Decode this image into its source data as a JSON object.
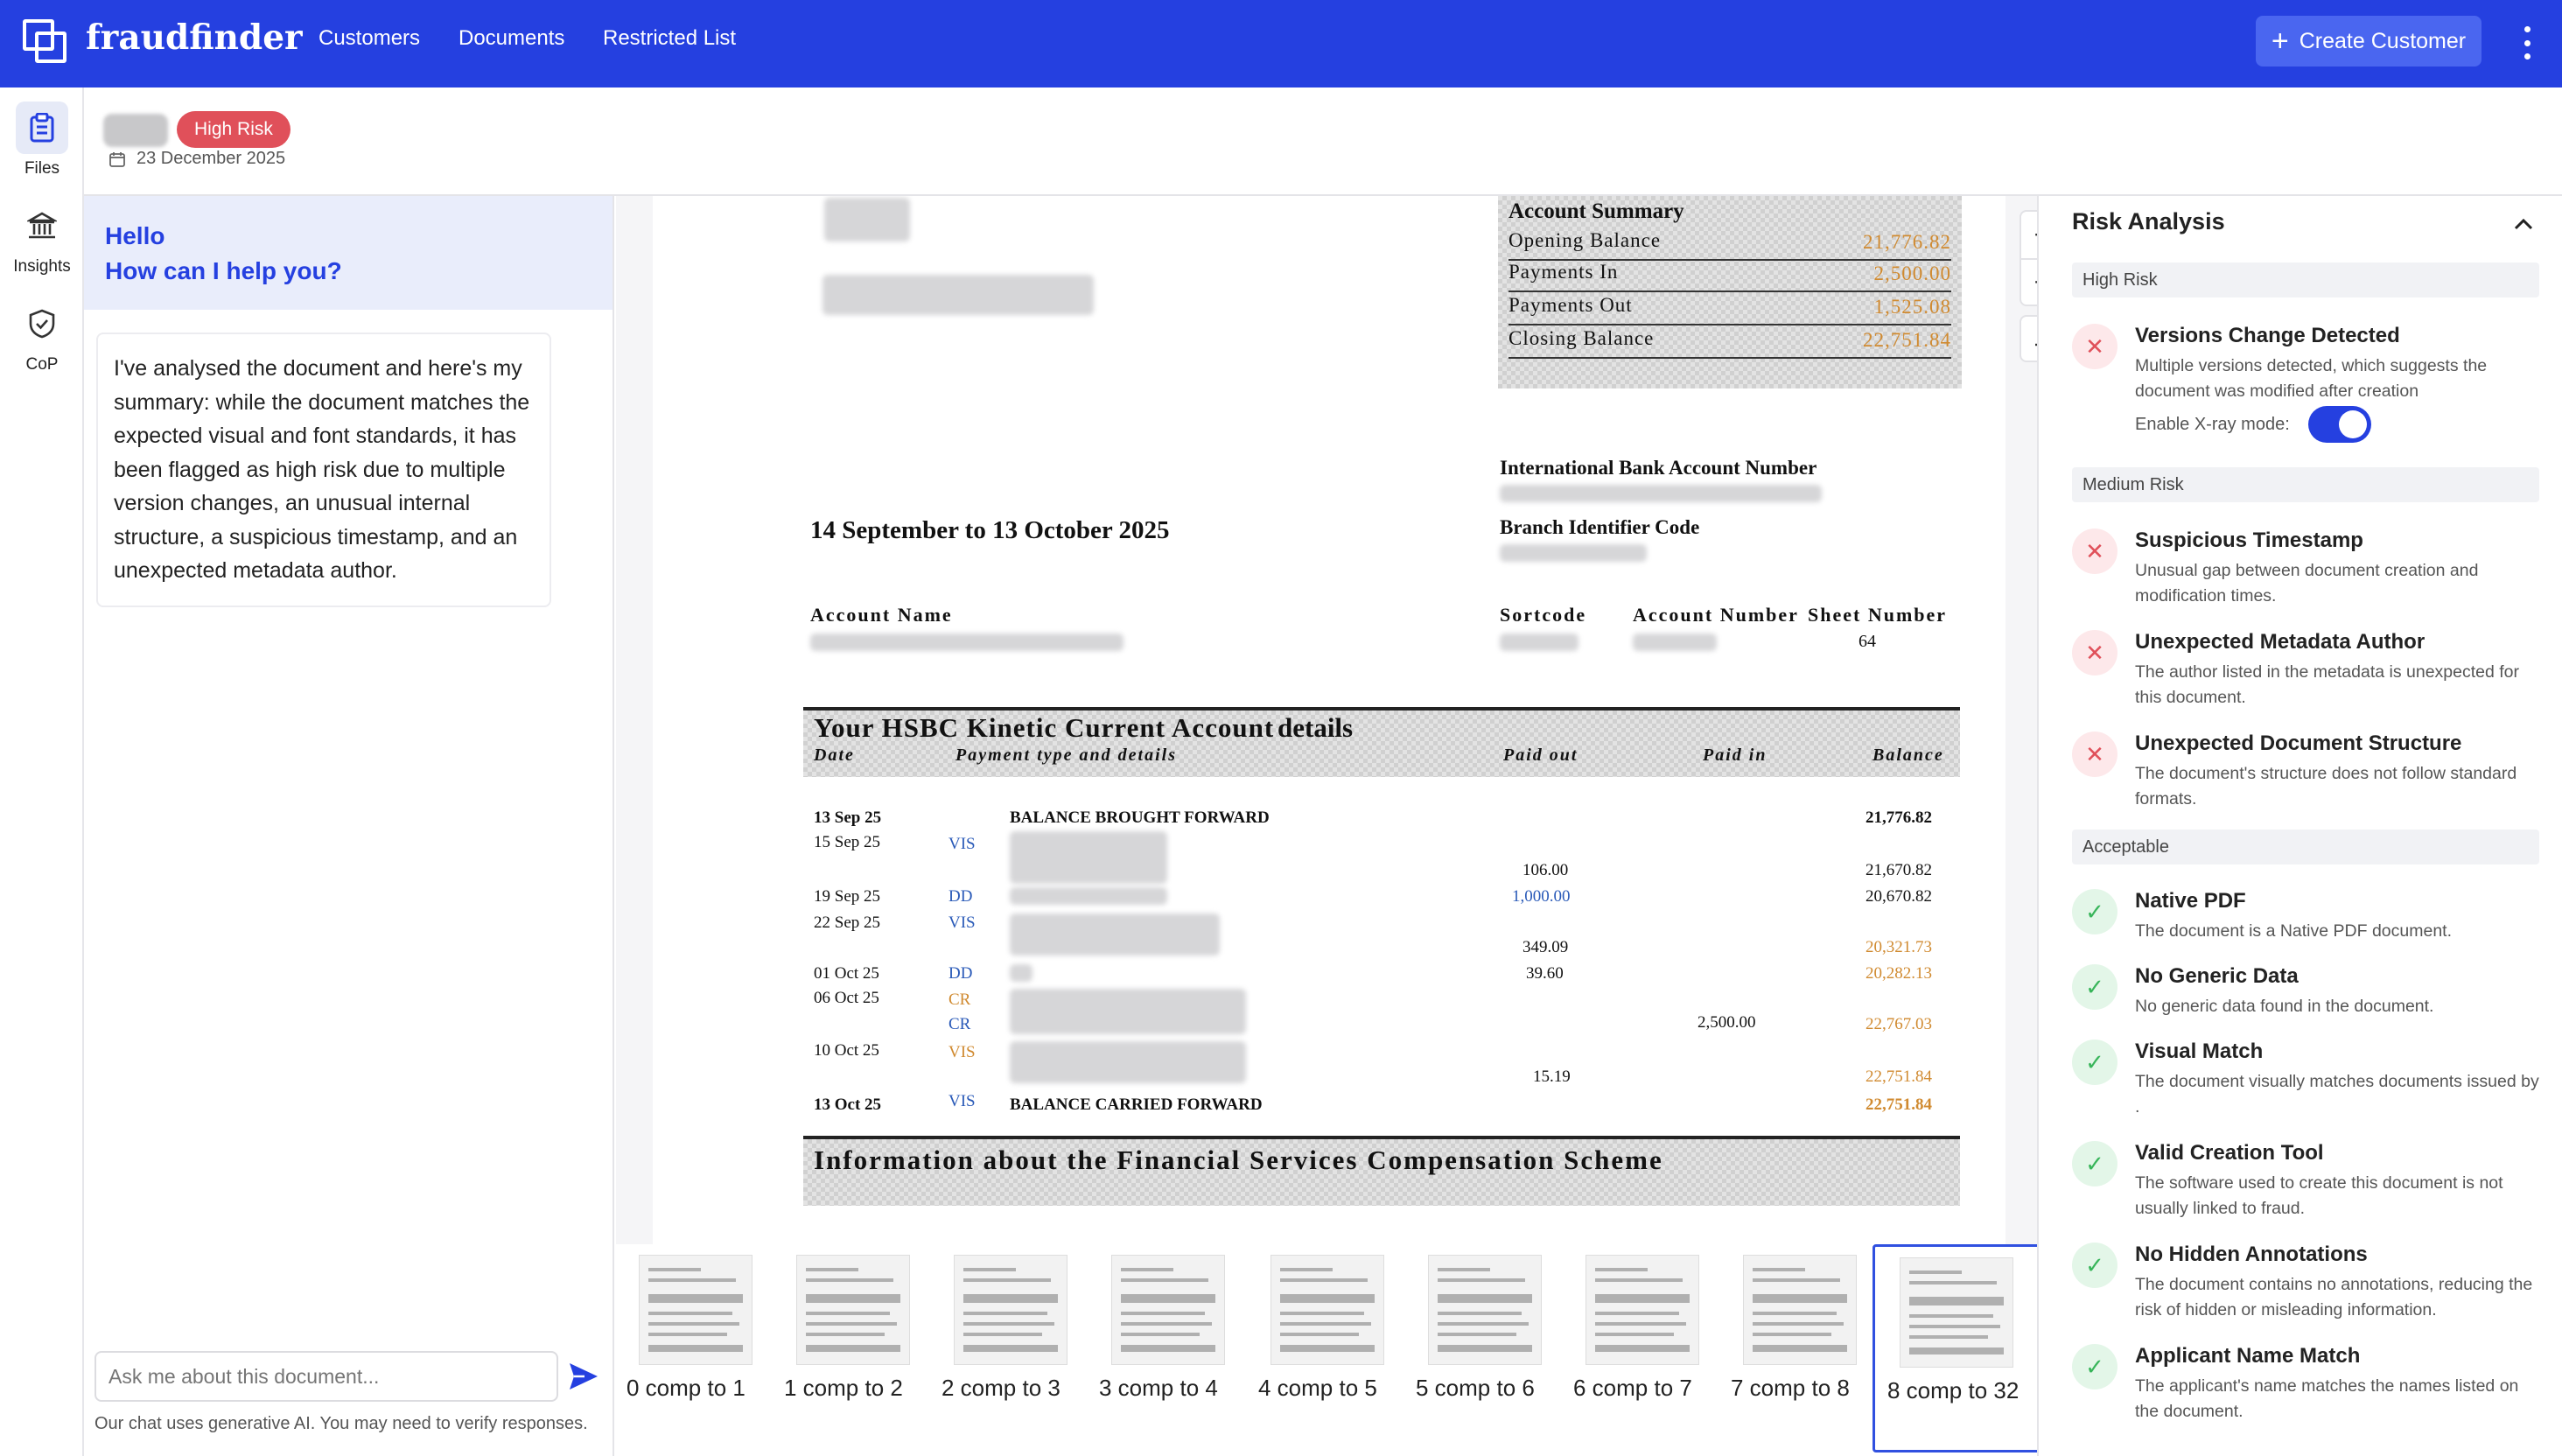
{
  "app": {
    "brand": "fraudfinder",
    "nav": [
      "Customers",
      "Documents",
      "Restricted List"
    ],
    "create_button": "Create Customer"
  },
  "rail": {
    "items": [
      {
        "label": "Files",
        "icon": "clipboard-icon"
      },
      {
        "label": "Insights",
        "icon": "bank-icon"
      },
      {
        "label": "CoP",
        "icon": "shield-check-icon"
      }
    ]
  },
  "header": {
    "risk_badge": "High Risk",
    "date": "23 December 2025"
  },
  "chat": {
    "greeting_1": "Hello",
    "greeting_2": "How can I help you?",
    "message": "I've analysed the document and here's my summary: while the document matches the expected visual and font standards, it has been flagged as high risk due to multiple version changes, an unusual internal structure, a suspicious timestamp, and an unexpected metadata author.",
    "input_placeholder": "Ask me about this document...",
    "disclaimer": "Our chat uses generative AI. You may need to verify responses."
  },
  "document": {
    "summary_title": "Account Summary",
    "summary_rows": [
      {
        "label": "Opening Balance",
        "value": "21,776.82"
      },
      {
        "label": "Payments In",
        "value": "2,500.00"
      },
      {
        "label": "Payments Out",
        "value": "1,525.08"
      },
      {
        "label": "Closing Balance",
        "value": "22,751.84"
      }
    ],
    "iban_label": "International Bank Account Number",
    "bic_label": "Branch Identifier Code",
    "period": "14 September to 13 October 2025",
    "account_name_label": "Account Name",
    "sortcode_label": "Sortcode",
    "account_number_label": "Account Number",
    "sheet_number_label": "Sheet Number",
    "sheet_number": "64",
    "account_title": "Your HSBC Kinetic Current Account",
    "details_word": "details",
    "col_date": "Date",
    "col_payment": "Payment type and details",
    "col_paid_out": "Paid out",
    "col_paid_in": "Paid in",
    "col_balance": "Balance",
    "transactions": [
      {
        "date": "13 Sep 25",
        "type": "",
        "details": "BALANCE BROUGHT FORWARD",
        "out": "",
        "in": "",
        "balance": "21,776.82"
      },
      {
        "date": "15 Sep 25",
        "type": "VIS",
        "details": "",
        "out": "106.00",
        "in": "",
        "balance": "21,670.82"
      },
      {
        "date": "19 Sep 25",
        "type": "DD",
        "details": "",
        "out": "1,000.00",
        "in": "",
        "balance": "20,670.82"
      },
      {
        "date": "22 Sep 25",
        "type": "VIS",
        "details": "",
        "out": "349.09",
        "in": "",
        "balance": "20,321.73"
      },
      {
        "date": "01 Oct 25",
        "type": "DD",
        "details": "",
        "out": "39.60",
        "in": "",
        "balance": "20,282.13"
      },
      {
        "date": "06 Oct 25",
        "type": "CR",
        "details": "",
        "out": "",
        "in": "",
        "balance": ""
      },
      {
        "date": "",
        "type": "CR",
        "details": "",
        "out": "",
        "in": "2,500.00",
        "balance": "22,767.03"
      },
      {
        "date": "10 Oct 25",
        "type": "VIS",
        "details": "",
        "out": "15.19",
        "in": "",
        "balance": "22,751.84"
      },
      {
        "date": "13 Oct 25",
        "type": "VIS",
        "details": "BALANCE CARRIED FORWARD",
        "out": "",
        "in": "",
        "balance": "22,751.84"
      }
    ],
    "fscs_title": "Information about the Financial Services Compensation Scheme"
  },
  "thumbnails": [
    "0 comp to 1",
    "1 comp to 2",
    "2 comp to 3",
    "3 comp to 4",
    "4 comp to 5",
    "5 comp to 6",
    "6 comp to 7",
    "7 comp to 8",
    "8 comp to 32"
  ],
  "risk": {
    "title": "Risk Analysis",
    "high_label": "High Risk",
    "versions": {
      "title": "Versions Change Detected",
      "desc": "Multiple versions detected, which suggests the document was modified after creation"
    },
    "xray_label": "Enable X-ray mode:",
    "xray_enabled": true,
    "medium_label": "Medium Risk",
    "medium_items": [
      {
        "title": "Suspicious Timestamp",
        "desc": "Unusual gap between document creation and modification times."
      },
      {
        "title": "Unexpected Metadata Author",
        "desc": "The author listed in the metadata is unexpected for this document."
      },
      {
        "title": "Unexpected Document Structure",
        "desc": "The document's structure does not follow standard formats."
      }
    ],
    "acceptable_label": "Acceptable",
    "acceptable_items": [
      {
        "title": "Native PDF",
        "desc": "The document is a Native PDF document."
      },
      {
        "title": "No Generic Data",
        "desc": "No generic data found in the document."
      },
      {
        "title": "Visual Match",
        "desc": "The document visually matches documents issued by ."
      },
      {
        "title": "Valid Creation Tool",
        "desc": "The software used to create this document is not usually linked to fraud."
      },
      {
        "title": "No Hidden Annotations",
        "desc": "The document contains no annotations, reducing the risk of hidden or misleading information."
      },
      {
        "title": "Applicant Name Match",
        "desc": "The applicant's name matches the names listed on the document."
      }
    ],
    "colors": {
      "bad": "#e0505a",
      "good": "#38b55a",
      "accent": "#2540e0"
    }
  }
}
